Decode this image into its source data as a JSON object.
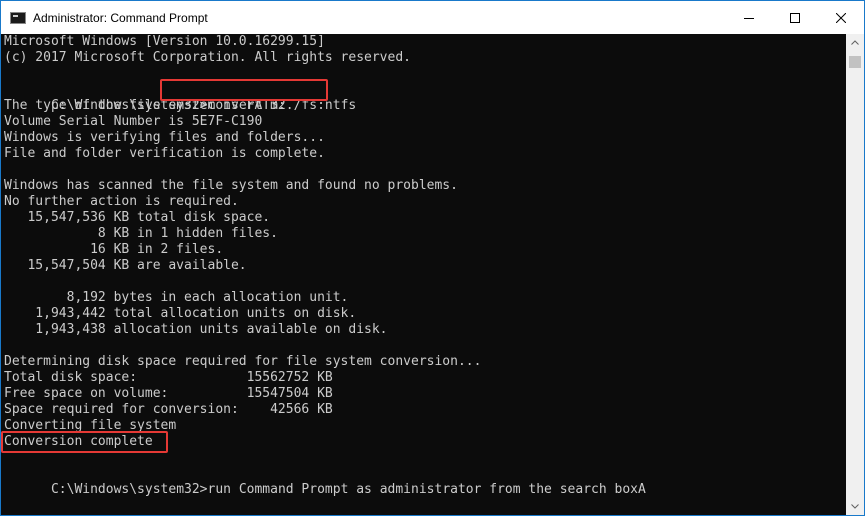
{
  "window": {
    "title": "Administrator: Command Prompt"
  },
  "titlebar_buttons": {
    "minimize_icon": "minimize-icon",
    "maximize_icon": "maximize-icon",
    "close_icon": "close-icon"
  },
  "console": {
    "lines": [
      "Microsoft Windows [Version 10.0.16299.15]",
      "(c) 2017 Microsoft Corporation. All rights reserved.",
      "",
      "",
      "The type of the file system is FAT32.",
      "Volume Serial Number is 5E7F-C190",
      "Windows is verifying files and folders...",
      "File and folder verification is complete.",
      "",
      "Windows has scanned the file system and found no problems.",
      "No further action is required.",
      "   15,547,536 KB total disk space.",
      "            8 KB in 1 hidden files.",
      "           16 KB in 2 files.",
      "   15,547,504 KB are available.",
      "",
      "        8,192 bytes in each allocation unit.",
      "    1,943,442 total allocation units on disk.",
      "    1,943,438 allocation units available on disk.",
      "",
      "Determining disk space required for file system conversion...",
      "Total disk space:              15562752 KB",
      "Free space on volume:          15547504 KB",
      "Space required for conversion:    42566 KB",
      "Converting file system",
      "Conversion complete",
      "",
      ""
    ],
    "command_line_1": {
      "prompt": "C:\\Windows\\system32>",
      "command": "convert m: /fs:ntfs"
    },
    "command_line_2": {
      "prompt": "C:\\Windows\\system32>",
      "command": "run Command Prompt as administrator from the search boxA"
    }
  },
  "colors": {
    "console_background": "#0c0c0c",
    "console_text": "#cccccc",
    "highlight": "#e53935",
    "window_border": "#1979ca"
  }
}
